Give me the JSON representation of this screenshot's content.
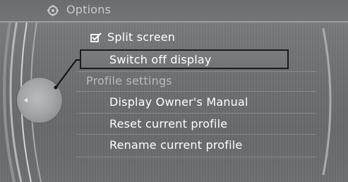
{
  "header": {
    "title": "Options",
    "icon": "gear-icon"
  },
  "menu": {
    "split_screen": {
      "label": "Split screen",
      "checked": true,
      "icon": "checkbox-checked-icon"
    },
    "switch_off_display": {
      "label": "Switch off display",
      "selected": true
    },
    "profile_section": {
      "label": "Profile settings"
    },
    "profile_items": [
      {
        "label": "Display Owner's Manual"
      },
      {
        "label": "Reset current profile"
      },
      {
        "label": "Rename current profile"
      }
    ]
  },
  "colors": {
    "background": "#707274",
    "text_active": "#ffffff",
    "text_inactive": "#b9bbbd",
    "selection_border": "#1b1b1b"
  }
}
